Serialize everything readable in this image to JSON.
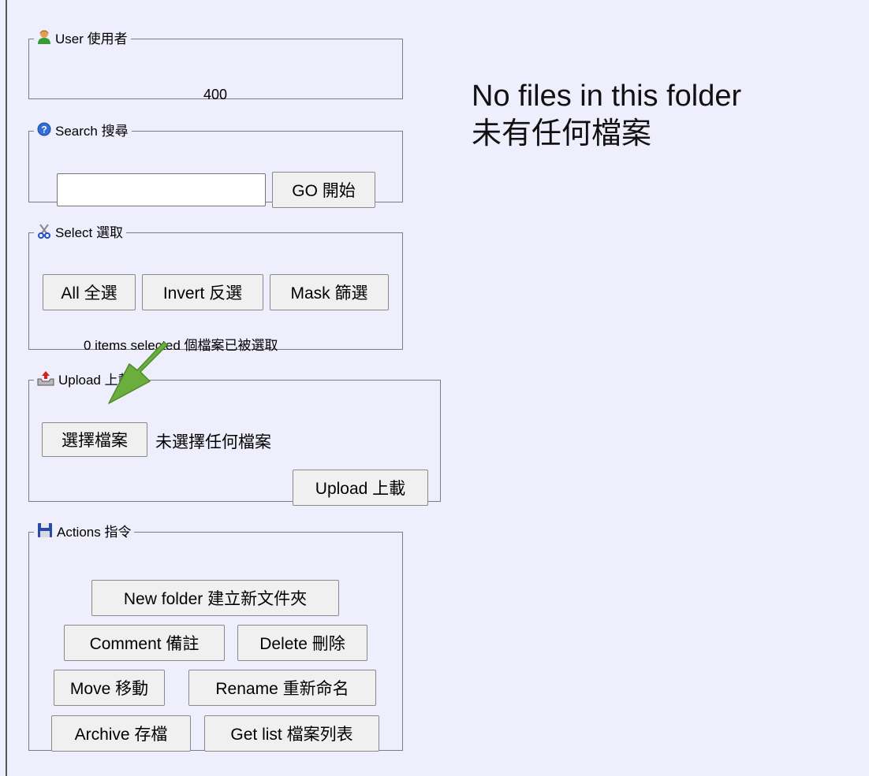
{
  "user": {
    "legend": "User 使用者",
    "value": "400",
    "icon": "user-icon"
  },
  "search": {
    "legend": "Search 搜尋",
    "icon": "help-icon",
    "input_value": "",
    "go_label": "GO 開始"
  },
  "select": {
    "legend": "Select 選取",
    "icon": "scissors-icon",
    "all_label": "All 全選",
    "invert_label": "Invert 反選",
    "mask_label": "Mask 篩選",
    "status": "0 items selected 個檔案已被選取"
  },
  "upload": {
    "legend": "Upload 上載",
    "icon": "upload-tray-icon",
    "choose_label": "選擇檔案",
    "no_file_text": "未選擇任何檔案",
    "upload_label": "Upload 上載"
  },
  "actions": {
    "legend": "Actions 指令",
    "icon": "floppy-disk-icon",
    "new_folder_label": "New folder 建立新文件夾",
    "comment_label": "Comment 備註",
    "delete_label": "Delete 刪除",
    "move_label": "Move 移動",
    "rename_label": "Rename 重新命名",
    "archive_label": "Archive 存檔",
    "get_list_label": "Get list 檔案列表"
  },
  "main": {
    "empty_en": "No files in this folder",
    "empty_zh": "未有任何檔案"
  },
  "colors": {
    "background": "#eeeefc",
    "arrow": "#6cae3e"
  }
}
